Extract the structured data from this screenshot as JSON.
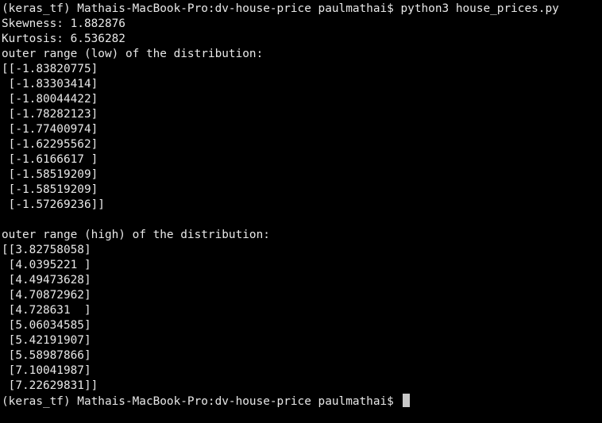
{
  "colors": {
    "background": "#000000",
    "text": "#e8e8e8",
    "cursor": "#c8c8c8"
  },
  "terminal": {
    "prompt": "(keras_tf) Mathais-MacBook-Pro:dv-house-price paulmathai$",
    "command": "python3 house_prices.py",
    "output": [
      "Skewness: 1.882876",
      "Kurtosis: 6.536282",
      "outer range (low) of the distribution:",
      "[[-1.83820775]",
      " [-1.83303414]",
      " [-1.80044422]",
      " [-1.78282123]",
      " [-1.77400974]",
      " [-1.62295562]",
      " [-1.6166617 ]",
      " [-1.58519209]",
      " [-1.58519209]",
      " [-1.57269236]]",
      "",
      "outer range (high) of the distribution:",
      "[[3.82758058]",
      " [4.0395221 ]",
      " [4.49473628]",
      " [4.70872962]",
      " [4.728631  ]",
      " [5.06034585]",
      " [5.42191907]",
      " [5.58987866]",
      " [7.10041987]",
      " [7.22629831]]"
    ],
    "final_prompt": "(keras_tf) Mathais-MacBook-Pro:dv-house-price paulmathai$"
  }
}
